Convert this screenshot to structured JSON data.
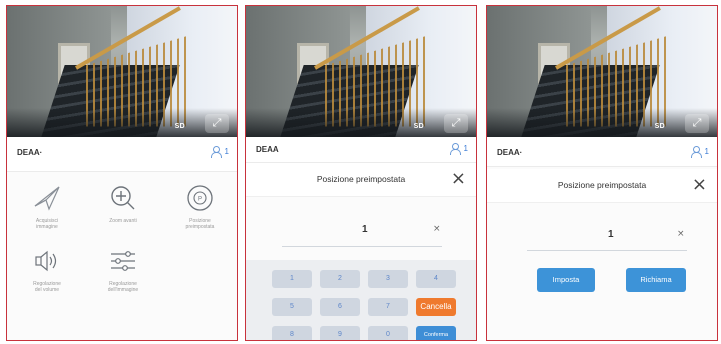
{
  "camera": {
    "quality": "SD",
    "fullscreen_icon": "fullscreen-icon"
  },
  "panel1": {
    "device_name": "DEAA·",
    "user_count": "1",
    "functions": [
      {
        "icon": "send-icon",
        "label": "Acquisisci\nimmagine"
      },
      {
        "icon": "zoom-in-icon",
        "label": "Zoom avanti"
      },
      {
        "icon": "preset-icon",
        "label": "Posizione\npreimpostata"
      },
      {
        "icon": "speaker-icon",
        "label": "Regolazione\ndel volume"
      },
      {
        "icon": "sliders-icon",
        "label": "Regolazione\ndell'immagine"
      }
    ]
  },
  "panel2": {
    "device_name": "DEAA",
    "user_count": "1",
    "title": "Posizione preimpostata",
    "value": "1",
    "clear_label": "×",
    "keys_row1": [
      "1",
      "2",
      "3",
      "4"
    ],
    "keys_row2": [
      "5",
      "6",
      "7"
    ],
    "keys_row3": [
      "8",
      "9",
      "0"
    ],
    "cancel_label": "Cancella",
    "confirm_label": "Conferma"
  },
  "panel3": {
    "device_name": "DEAA·",
    "user_count": "1",
    "title": "Posizione preimpostata",
    "value": "1",
    "clear_label": "×",
    "set_button": "Imposta",
    "recall_button": "Richiama"
  }
}
